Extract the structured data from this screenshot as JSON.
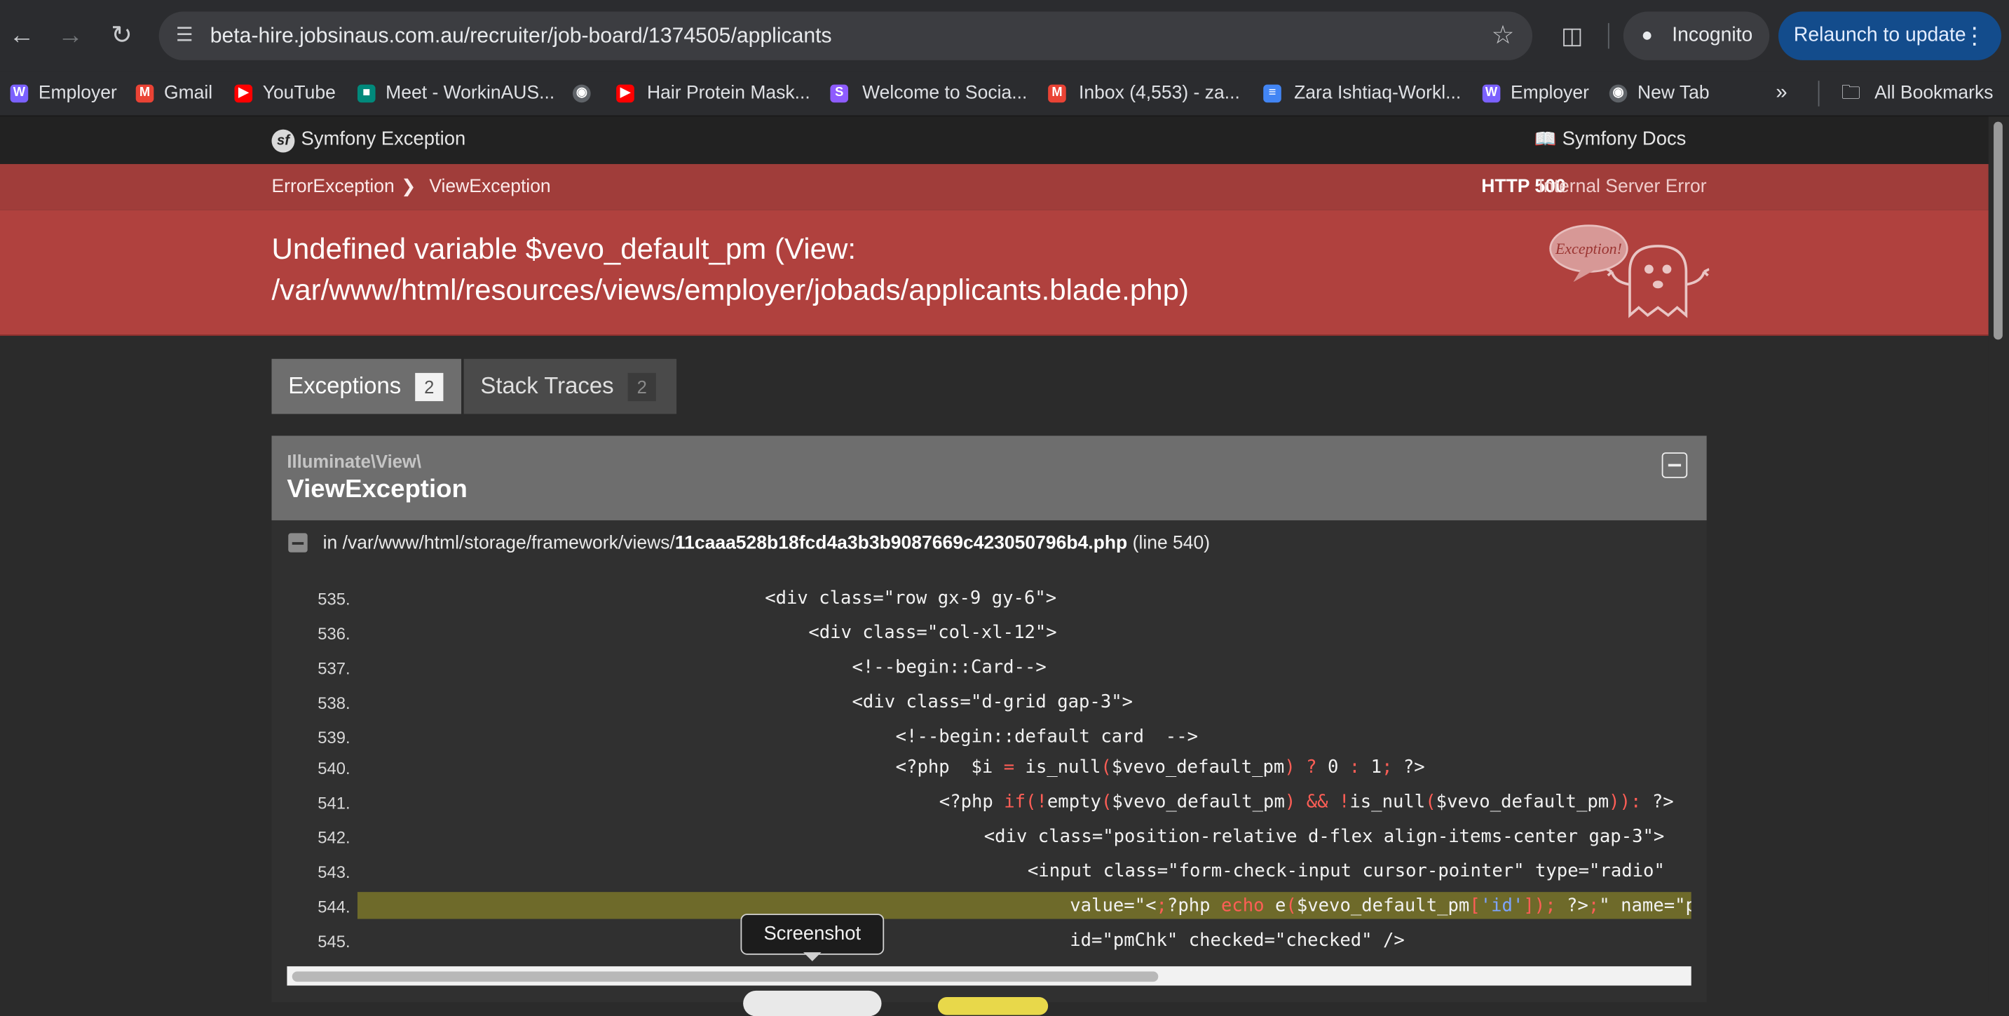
{
  "browser": {
    "url": "beta-hire.jobsinaus.com.au/recruiter/job-board/1374505/applicants",
    "incognito_label": "Incognito",
    "relaunch_label": "Relaunch to update",
    "bookmarks": [
      {
        "label": "Employer",
        "icon": "workinaus-icon",
        "color": "#7b61ff"
      },
      {
        "label": "Gmail",
        "icon": "gmail-icon",
        "color": "#ea4335"
      },
      {
        "label": "YouTube",
        "icon": "youtube-icon",
        "color": "#ff0000"
      },
      {
        "label": "Meet - WorkinAUS...",
        "icon": "meet-icon",
        "color": "#00897b"
      },
      {
        "label": "",
        "icon": "globe-icon",
        "color": "#9aa0a6"
      },
      {
        "label": "Hair Protein Mask...",
        "icon": "youtube-icon",
        "color": "#ff0000"
      },
      {
        "label": "Welcome to Socia...",
        "icon": "social-icon",
        "color": "#8e5cff"
      },
      {
        "label": "Inbox (4,553) - za...",
        "icon": "gmail-icon",
        "color": "#ea4335"
      },
      {
        "label": "Zara Ishtiaq-Workl...",
        "icon": "docs-icon",
        "color": "#4285f4"
      },
      {
        "label": "Employer",
        "icon": "workinaus-icon",
        "color": "#7b61ff"
      },
      {
        "label": "New Tab",
        "icon": "globe-icon",
        "color": "#9aa0a6"
      }
    ],
    "all_bookmarks_label": "All Bookmarks"
  },
  "symfony": {
    "header_title": "Symfony Exception",
    "docs_label": "Symfony Docs",
    "breadcrumb": [
      "ErrorException",
      "ViewException"
    ],
    "http_code": "HTTP 500",
    "http_text": "Internal Server Error",
    "message": "Undefined variable $vevo_default_pm (View: /var/www/html/resources/views/employer/jobads/applicants.blade.php)",
    "ghost_label": "Exception!",
    "tabs": [
      {
        "label": "Exceptions",
        "count": "2"
      },
      {
        "label": "Stack Traces",
        "count": "2"
      }
    ],
    "exception": {
      "namespace": "Illuminate\\View\\",
      "class": "ViewException",
      "file_prefix": "in /var/www/html/storage/framework/views/",
      "file_name": "11caaa528b18fcd4a3b3b9087669c423050796b4.php",
      "file_line": "(line 540)"
    },
    "code": [
      {
        "num": "535.",
        "text": "<div class=\"row gx-9 gy-6\">"
      },
      {
        "num": "536.",
        "text": "<div class=\"col-xl-12\">"
      },
      {
        "num": "537.",
        "text": "<!--begin::Card-->"
      },
      {
        "num": "538.",
        "text": "<div class=\"d-grid gap-3\">"
      },
      {
        "num": "539.",
        "text": "<!--begin::default card  -->"
      },
      {
        "num": "540.",
        "text": "<?php  $i = is_null($vevo_default_pm) ? 0 : 1; ?>"
      },
      {
        "num": "541.",
        "text": "<?php if(!empty($vevo_default_pm) && !is_null($vevo_default_pm)): ?>"
      },
      {
        "num": "542.",
        "text": "<div class=\"position-relative d-flex align-items-center gap-3\">"
      },
      {
        "num": "543.",
        "text": "<input class=\"form-check-input cursor-pointer\" type=\"radio\""
      },
      {
        "num": "544.",
        "text": "value=\"<?php echo e($vevo_default_pm['id']); ?>\" name=\"pm"
      },
      {
        "num": "545.",
        "text": "id=\"pmChk\" checked=\"checked\" />"
      }
    ]
  },
  "tooltip": "Screenshot",
  "colors": {
    "error_red": "#b0413e",
    "highlight": "#6e6a2a",
    "relaunch_bg": "#134c8c"
  }
}
